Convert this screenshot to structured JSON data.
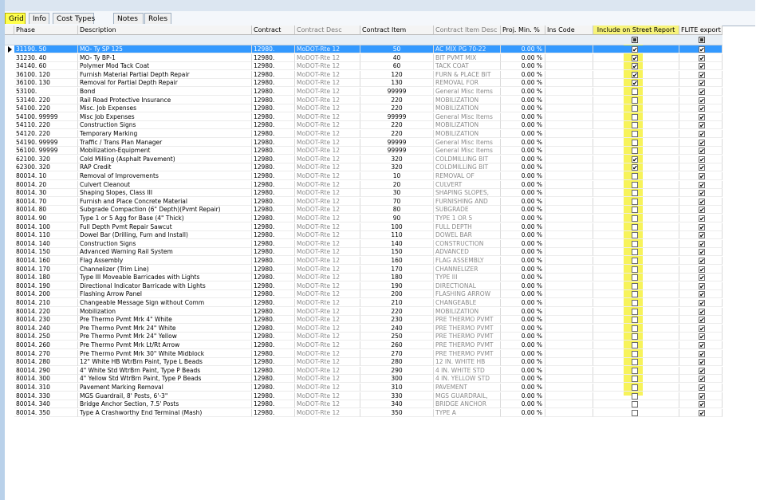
{
  "tabs": [
    {
      "label": "Grid",
      "active": true
    },
    {
      "label": "Info",
      "active": false
    },
    {
      "label": "Cost Types",
      "active": false
    },
    {
      "label": "Notes",
      "active": false
    },
    {
      "label": "Roles",
      "active": false
    }
  ],
  "columns": {
    "phase": "Phase",
    "description": "Description",
    "contract": "Contract",
    "contract_desc": "Contract Desc",
    "contract_item": "Contract Item",
    "contract_item_desc": "Contract Item Desc",
    "proj_min": "Proj. Min. %",
    "ins_code": "Ins Code",
    "include_street": "Include on Street Report",
    "flite_export": "FLITE export"
  },
  "colors": {
    "highlight": "#ffff4d",
    "selected_row": "#3399ff"
  },
  "rows": [
    {
      "phase": "31190. 50",
      "description": "MO- Ty SP 125",
      "contract": "12980.",
      "contract_desc": "MoDOT-Rte 12",
      "contract_item": "50",
      "contract_item_desc": "AC MIX PG 70-22",
      "proj_min": "0.00 %",
      "street": true,
      "flite": true,
      "selected": true
    },
    {
      "phase": "31230. 40",
      "description": "MO- Ty BP-1",
      "contract": "12980.",
      "contract_desc": "MoDOT-Rte 12",
      "contract_item": "40",
      "contract_item_desc": "BIT PVMT MIX",
      "proj_min": "0.00 %",
      "street": true,
      "flite": true
    },
    {
      "phase": "34140. 60",
      "description": "Polymer Mod Tack Coat",
      "contract": "12980.",
      "contract_desc": "MoDOT-Rte 12",
      "contract_item": "60",
      "contract_item_desc": "TACK COAT",
      "proj_min": "0.00 %",
      "street": true,
      "flite": true
    },
    {
      "phase": "36100. 120",
      "description": "Furnish Material Partial Depth Repair",
      "contract": "12980.",
      "contract_desc": "MoDOT-Rte 12",
      "contract_item": "120",
      "contract_item_desc": "FURN & PLACE BIT",
      "proj_min": "0.00 %",
      "street": true,
      "flite": true
    },
    {
      "phase": "36100. 130",
      "description": "Removal for Partial Depth Repair",
      "contract": "12980.",
      "contract_desc": "MoDOT-Rte 12",
      "contract_item": "130",
      "contract_item_desc": "REMOVAL FOR",
      "proj_min": "0.00 %",
      "street": true,
      "flite": true
    },
    {
      "phase": "53100.",
      "description": "Bond",
      "contract": "12980.",
      "contract_desc": "MoDOT-Rte 12",
      "contract_item": "99999",
      "contract_item_desc": "General Misc Items",
      "proj_min": "0.00 %",
      "street": false,
      "flite": true
    },
    {
      "phase": "53140. 220",
      "description": "Rail Road Protective Insurance",
      "contract": "12980.",
      "contract_desc": "MoDOT-Rte 12",
      "contract_item": "220",
      "contract_item_desc": "MOBILIZATION",
      "proj_min": "0.00 %",
      "street": false,
      "flite": true
    },
    {
      "phase": "54100. 220",
      "description": "Misc. Job Expenses",
      "contract": "12980.",
      "contract_desc": "MoDOT-Rte 12",
      "contract_item": "220",
      "contract_item_desc": "MOBILIZATION",
      "proj_min": "0.00 %",
      "street": false,
      "flite": true
    },
    {
      "phase": "54100. 99999",
      "description": "Misc Job Expenses",
      "contract": "12980.",
      "contract_desc": "MoDOT-Rte 12",
      "contract_item": "99999",
      "contract_item_desc": "General Misc Items",
      "proj_min": "0.00 %",
      "street": false,
      "flite": true
    },
    {
      "phase": "54110. 220",
      "description": "Construction Signs",
      "contract": "12980.",
      "contract_desc": "MoDOT-Rte 12",
      "contract_item": "220",
      "contract_item_desc": "MOBILIZATION",
      "proj_min": "0.00 %",
      "street": false,
      "flite": true
    },
    {
      "phase": "54120. 220",
      "description": "Temporary Marking",
      "contract": "12980.",
      "contract_desc": "MoDOT-Rte 12",
      "contract_item": "220",
      "contract_item_desc": "MOBILIZATION",
      "proj_min": "0.00 %",
      "street": false,
      "flite": true
    },
    {
      "phase": "54190. 99999",
      "description": "Traffic / Trans Plan Manager",
      "contract": "12980.",
      "contract_desc": "MoDOT-Rte 12",
      "contract_item": "99999",
      "contract_item_desc": "General Misc Items",
      "proj_min": "0.00 %",
      "street": false,
      "flite": true
    },
    {
      "phase": "56100. 99999",
      "description": "Mobilization-Equipment",
      "contract": "12980.",
      "contract_desc": "MoDOT-Rte 12",
      "contract_item": "99999",
      "contract_item_desc": "General Misc Items",
      "proj_min": "0.00 %",
      "street": false,
      "flite": true
    },
    {
      "phase": "62100. 320",
      "description": "Cold Milling (Asphalt Pavement)",
      "contract": "12980.",
      "contract_desc": "MoDOT-Rte 12",
      "contract_item": "320",
      "contract_item_desc": "COLDMILLING BIT",
      "proj_min": "0.00 %",
      "street": true,
      "flite": true
    },
    {
      "phase": "62300. 320",
      "description": "RAP Credit",
      "contract": "12980.",
      "contract_desc": "MoDOT-Rte 12",
      "contract_item": "320",
      "contract_item_desc": "COLDMILLING BIT",
      "proj_min": "0.00 %",
      "street": true,
      "flite": true
    },
    {
      "phase": "80014. 10",
      "description": "Removal of Improvements",
      "contract": "12980.",
      "contract_desc": "MoDOT-Rte 12",
      "contract_item": "10",
      "contract_item_desc": "REMOVAL OF",
      "proj_min": "0.00 %",
      "street": false,
      "flite": true
    },
    {
      "phase": "80014. 20",
      "description": "Culvert Cleanout",
      "contract": "12980.",
      "contract_desc": "MoDOT-Rte 12",
      "contract_item": "20",
      "contract_item_desc": "CULVERT",
      "proj_min": "0.00 %",
      "street": false,
      "flite": true
    },
    {
      "phase": "80014. 30",
      "description": "Shaping Slopes, Class III",
      "contract": "12980.",
      "contract_desc": "MoDOT-Rte 12",
      "contract_item": "30",
      "contract_item_desc": "SHAPING SLOPES,",
      "proj_min": "0.00 %",
      "street": false,
      "flite": true
    },
    {
      "phase": "80014. 70",
      "description": "Furnish and Place Concrete Material",
      "contract": "12980.",
      "contract_desc": "MoDOT-Rte 12",
      "contract_item": "70",
      "contract_item_desc": "FURNISHING AND",
      "proj_min": "0.00 %",
      "street": false,
      "flite": true
    },
    {
      "phase": "80014. 80",
      "description": "Subgrade Compaction (6\" Depth)(Pvmt Repair)",
      "contract": "12980.",
      "contract_desc": "MoDOT-Rte 12",
      "contract_item": "80",
      "contract_item_desc": "SUBGRADE",
      "proj_min": "0.00 %",
      "street": false,
      "flite": true
    },
    {
      "phase": "80014. 90",
      "description": "Type 1 or 5 Agg for Base (4\" Thick)",
      "contract": "12980.",
      "contract_desc": "MoDOT-Rte 12",
      "contract_item": "90",
      "contract_item_desc": "TYPE 1 OR 5",
      "proj_min": "0.00 %",
      "street": false,
      "flite": true
    },
    {
      "phase": "80014. 100",
      "description": "Full Depth Pvmt Repair Sawcut",
      "contract": "12980.",
      "contract_desc": "MoDOT-Rte 12",
      "contract_item": "100",
      "contract_item_desc": "FULL DEPTH",
      "proj_min": "0.00 %",
      "street": false,
      "flite": true
    },
    {
      "phase": "80014. 110",
      "description": "Dowel Bar (Drilling, Furn and Install)",
      "contract": "12980.",
      "contract_desc": "MoDOT-Rte 12",
      "contract_item": "110",
      "contract_item_desc": "DOWEL BAR",
      "proj_min": "0.00 %",
      "street": false,
      "flite": true
    },
    {
      "phase": "80014. 140",
      "description": "Construction Signs",
      "contract": "12980.",
      "contract_desc": "MoDOT-Rte 12",
      "contract_item": "140",
      "contract_item_desc": "CONSTRUCTION",
      "proj_min": "0.00 %",
      "street": false,
      "flite": true
    },
    {
      "phase": "80014. 150",
      "description": "Advanced Warning Rail System",
      "contract": "12980.",
      "contract_desc": "MoDOT-Rte 12",
      "contract_item": "150",
      "contract_item_desc": "ADVANCED",
      "proj_min": "0.00 %",
      "street": false,
      "flite": true
    },
    {
      "phase": "80014. 160",
      "description": "Flag Assembly",
      "contract": "12980.",
      "contract_desc": "MoDOT-Rte 12",
      "contract_item": "160",
      "contract_item_desc": "FLAG ASSEMBLY",
      "proj_min": "0.00 %",
      "street": false,
      "flite": true
    },
    {
      "phase": "80014. 170",
      "description": "Channelizer (Trim Line)",
      "contract": "12980.",
      "contract_desc": "MoDOT-Rte 12",
      "contract_item": "170",
      "contract_item_desc": "CHANNELIZER",
      "proj_min": "0.00 %",
      "street": false,
      "flite": true
    },
    {
      "phase": "80014. 180",
      "description": "Type III Moveable Barricades with Lights",
      "contract": "12980.",
      "contract_desc": "MoDOT-Rte 12",
      "contract_item": "180",
      "contract_item_desc": "TYPE III",
      "proj_min": "0.00 %",
      "street": false,
      "flite": true
    },
    {
      "phase": "80014. 190",
      "description": "Directional Indicator Barricade with Lights",
      "contract": "12980.",
      "contract_desc": "MoDOT-Rte 12",
      "contract_item": "190",
      "contract_item_desc": "DIRECTIONAL",
      "proj_min": "0.00 %",
      "street": false,
      "flite": true
    },
    {
      "phase": "80014. 200",
      "description": "Flashing Arrow Panel",
      "contract": "12980.",
      "contract_desc": "MoDOT-Rte 12",
      "contract_item": "200",
      "contract_item_desc": "FLASHING ARROW",
      "proj_min": "0.00 %",
      "street": false,
      "flite": true
    },
    {
      "phase": "80014. 210",
      "description": "Changeable Message Sign without Comm",
      "contract": "12980.",
      "contract_desc": "MoDOT-Rte 12",
      "contract_item": "210",
      "contract_item_desc": "CHANGEABLE",
      "proj_min": "0.00 %",
      "street": false,
      "flite": true
    },
    {
      "phase": "80014. 220",
      "description": "Mobilization",
      "contract": "12980.",
      "contract_desc": "MoDOT-Rte 12",
      "contract_item": "220",
      "contract_item_desc": "MOBILIZATION",
      "proj_min": "0.00 %",
      "street": false,
      "flite": true
    },
    {
      "phase": "80014. 230",
      "description": "Pre Thermo Pvmt Mrk 4\" White",
      "contract": "12980.",
      "contract_desc": "MoDOT-Rte 12",
      "contract_item": "230",
      "contract_item_desc": "PRE THERMO PVMT",
      "proj_min": "0.00 %",
      "street": false,
      "flite": true
    },
    {
      "phase": "80014. 240",
      "description": "Pre Thermo Pvmt Mrk 24\" White",
      "contract": "12980.",
      "contract_desc": "MoDOT-Rte 12",
      "contract_item": "240",
      "contract_item_desc": "PRE THERMO PVMT",
      "proj_min": "0.00 %",
      "street": false,
      "flite": true
    },
    {
      "phase": "80014. 250",
      "description": "Pre Thermo Pvmt Mrk 24\" Yellow",
      "contract": "12980.",
      "contract_desc": "MoDOT-Rte 12",
      "contract_item": "250",
      "contract_item_desc": "PRE THERMO PVMT",
      "proj_min": "0.00 %",
      "street": false,
      "flite": true
    },
    {
      "phase": "80014. 260",
      "description": "Pre Thermo Pvmt Mrk Lt/Rt Arrow",
      "contract": "12980.",
      "contract_desc": "MoDOT-Rte 12",
      "contract_item": "260",
      "contract_item_desc": "PRE THERMO PVMT",
      "proj_min": "0.00 %",
      "street": false,
      "flite": true
    },
    {
      "phase": "80014. 270",
      "description": "Pre Thermo Pvmt Mrk 30\" White Midblock",
      "contract": "12980.",
      "contract_desc": "MoDOT-Rte 12",
      "contract_item": "270",
      "contract_item_desc": "PRE THERMO PVMT",
      "proj_min": "0.00 %",
      "street": false,
      "flite": true
    },
    {
      "phase": "80014. 280",
      "description": "12\" White HB WtrBrn Paint, Type L Beads",
      "contract": "12980.",
      "contract_desc": "MoDOT-Rte 12",
      "contract_item": "280",
      "contract_item_desc": "12 IN. WHITE HB",
      "proj_min": "0.00 %",
      "street": false,
      "flite": true
    },
    {
      "phase": "80014. 290",
      "description": "4\" White Std WtrBrn Paint, Type P Beads",
      "contract": "12980.",
      "contract_desc": "MoDOT-Rte 12",
      "contract_item": "290",
      "contract_item_desc": "4 IN. WHITE STD",
      "proj_min": "0.00 %",
      "street": false,
      "flite": true
    },
    {
      "phase": "80014. 300",
      "description": "4\" Yellow Std WtrBrn Paint, Type P Beads",
      "contract": "12980.",
      "contract_desc": "MoDOT-Rte 12",
      "contract_item": "300",
      "contract_item_desc": "4 IN. YELLOW STD",
      "proj_min": "0.00 %",
      "street": false,
      "flite": true
    },
    {
      "phase": "80014. 310",
      "description": "Pavement Marking Removal",
      "contract": "12980.",
      "contract_desc": "MoDOT-Rte 12",
      "contract_item": "310",
      "contract_item_desc": "PAVEMENT",
      "proj_min": "0.00 %",
      "street": false,
      "flite": true
    },
    {
      "phase": "80014. 330",
      "description": "MGS Guardrail, 8' Posts, 6'-3\"",
      "contract": "12980.",
      "contract_desc": "MoDOT-Rte 12",
      "contract_item": "330",
      "contract_item_desc": "MGS GUARDRAIL,",
      "proj_min": "0.00 %",
      "street": false,
      "flite": true
    },
    {
      "phase": "80014. 340",
      "description": "Bridge Anchor Section, 7.5' Posts",
      "contract": "12980.",
      "contract_desc": "MoDOT-Rte 12",
      "contract_item": "340",
      "contract_item_desc": "BRIDGE ANCHOR",
      "proj_min": "0.00 %",
      "street": false,
      "flite": true
    },
    {
      "phase": "80014. 350",
      "description": "Type A Crashworthy End Terminal (Mash)",
      "contract": "12980.",
      "contract_desc": "MoDOT-Rte 12",
      "contract_item": "350",
      "contract_item_desc": "TYPE A",
      "proj_min": "0.00 %",
      "street": false,
      "flite": true
    }
  ]
}
